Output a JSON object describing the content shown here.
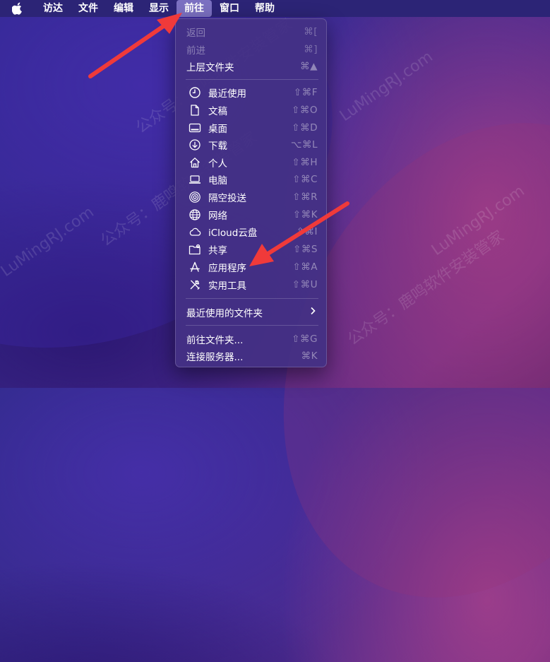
{
  "menubar": {
    "items": [
      {
        "label": "访达"
      },
      {
        "label": "文件"
      },
      {
        "label": "编辑"
      },
      {
        "label": "显示"
      },
      {
        "label": "前往"
      },
      {
        "label": "窗口"
      },
      {
        "label": "帮助"
      }
    ]
  },
  "menu": {
    "back": {
      "label": "返回",
      "shortcut": "⌘["
    },
    "forward": {
      "label": "前进",
      "shortcut": "⌘]"
    },
    "enclosing": {
      "label": "上层文件夹",
      "shortcut": "⌘▲"
    },
    "items": [
      {
        "label": "最近使用",
        "shortcut": "⇧⌘F"
      },
      {
        "label": "文稿",
        "shortcut": "⇧⌘O"
      },
      {
        "label": "桌面",
        "shortcut": "⇧⌘D"
      },
      {
        "label": "下载",
        "shortcut": "⌥⌘L"
      },
      {
        "label": "个人",
        "shortcut": "⇧⌘H"
      },
      {
        "label": "电脑",
        "shortcut": "⇧⌘C"
      },
      {
        "label": "隔空投送",
        "shortcut": "⇧⌘R"
      },
      {
        "label": "网络",
        "shortcut": "⇧⌘K"
      },
      {
        "label": "iCloud云盘",
        "shortcut": "⇧⌘I"
      },
      {
        "label": "共享",
        "shortcut": "⇧⌘S"
      },
      {
        "label": "应用程序",
        "shortcut": "⇧⌘A"
      },
      {
        "label": "实用工具",
        "shortcut": "⇧⌘U"
      }
    ],
    "recent_folders": {
      "label": "最近使用的文件夹"
    },
    "goto_folder": {
      "label": "前往文件夹...",
      "shortcut": "⇧⌘G"
    },
    "connect_server": {
      "label": "连接服务器...",
      "shortcut": "⌘K"
    }
  },
  "watermark": {
    "lines": [
      "公众号：鹿鸣软件安装管家",
      "LuMingRJ.com"
    ]
  }
}
